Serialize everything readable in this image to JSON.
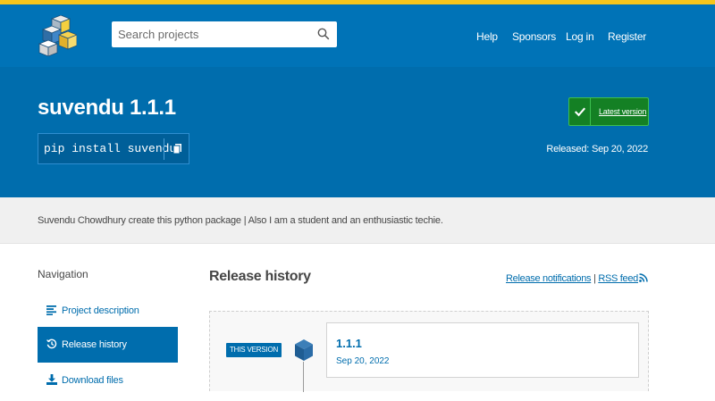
{
  "header": {
    "search_placeholder": "Search projects",
    "nav": [
      "Help",
      "Sponsors",
      "Log in",
      "Register"
    ]
  },
  "package": {
    "title": "suvendu 1.1.1",
    "pip_command": "pip install suvendu",
    "latest_label": "Latest version",
    "released": "Released: Sep 20, 2022"
  },
  "description": "Suvendu Chowdhury create this python package | Also I am a student and an enthusiastic techie.",
  "sidebar": {
    "heading": "Navigation",
    "items": [
      {
        "label": "Project description",
        "icon": "align-left-icon"
      },
      {
        "label": "Release history",
        "icon": "history-icon"
      },
      {
        "label": "Download files",
        "icon": "download-icon"
      }
    ]
  },
  "main": {
    "title": "Release history",
    "notifications_link": "Release notifications",
    "separator": " | ",
    "rss_link": "RSS feed",
    "releases": [
      {
        "badge": "THIS VERSION",
        "version": "1.1.1",
        "date": "Sep 20, 2022"
      }
    ]
  },
  "colors": {
    "header": "#0073b7",
    "banner": "#006dad",
    "accent": "#f5c51c",
    "latest_green": "#148024"
  }
}
